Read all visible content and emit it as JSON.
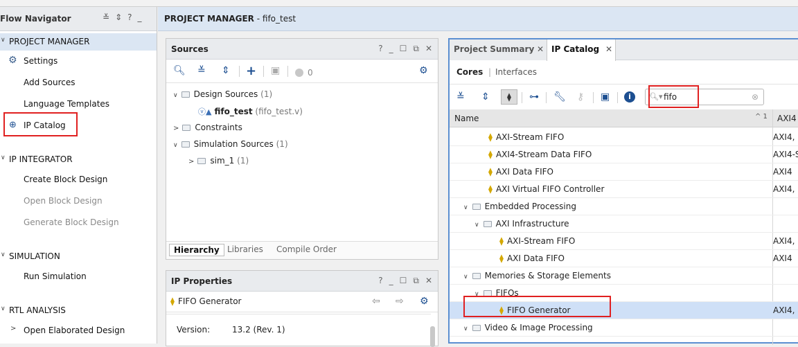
{
  "flow_navigator": {
    "title": "Flow Navigator",
    "header_icons": [
      "≚",
      "⇕",
      "?",
      "_"
    ],
    "sections": [
      {
        "label": "PROJECT MANAGER",
        "items": [
          {
            "label": "Settings",
            "disabled": false
          },
          {
            "label": "Add Sources",
            "disabled": false
          },
          {
            "label": "Language Templates",
            "disabled": false
          },
          {
            "label": "IP Catalog",
            "disabled": false
          }
        ]
      },
      {
        "label": "IP INTEGRATOR",
        "items": [
          {
            "label": "Create Block Design",
            "disabled": false
          },
          {
            "label": "Open Block Design",
            "disabled": true
          },
          {
            "label": "Generate Block Design",
            "disabled": true
          }
        ]
      },
      {
        "label": "SIMULATION",
        "items": [
          {
            "label": "Run Simulation",
            "disabled": false
          }
        ]
      },
      {
        "label": "RTL ANALYSIS",
        "items": [
          {
            "label": "Open Elaborated Design",
            "disabled": false
          }
        ]
      }
    ]
  },
  "project_manager_bar": {
    "prefix": "PROJECT MANAGER",
    "suffix": " - fifo_test"
  },
  "sources": {
    "title": "Sources",
    "count_badge": "0",
    "tree": {
      "design_sources": {
        "label": "Design Sources",
        "count": "(1)"
      },
      "top_file": {
        "name": "fifo_test",
        "file": "(fifo_test.v)"
      },
      "constraints": {
        "label": "Constraints"
      },
      "simulation_sources": {
        "label": "Simulation Sources",
        "count": "(1)"
      },
      "sim_1": {
        "label": "sim_1",
        "count": "(1)"
      }
    },
    "tabs": [
      "Hierarchy",
      "Libraries",
      "Compile Order"
    ]
  },
  "ip_properties": {
    "title": "IP Properties",
    "ip_name": "FIFO Generator",
    "version_label": "Version:",
    "version_value": "13.2 (Rev. 1)"
  },
  "ip_catalog": {
    "tabs": [
      "Project Summary",
      "IP Catalog"
    ],
    "subtabs": {
      "cores": "Cores",
      "separator": "|",
      "interfaces": "Interfaces"
    },
    "search": {
      "value": "fifo"
    },
    "columns": {
      "name": "Name",
      "sort_indicator": "^ 1",
      "col2": "AXI4"
    },
    "rows": [
      {
        "type": "ip",
        "label": "AXI-Stream FIFO",
        "col2": "AXI4,",
        "level": 2,
        "selected": false
      },
      {
        "type": "ip",
        "label": "AXI4-Stream Data FIFO",
        "col2": "AXI4-S",
        "level": 2,
        "selected": false
      },
      {
        "type": "ip",
        "label": "AXI Data FIFO",
        "col2": "AXI4",
        "level": 2,
        "selected": false
      },
      {
        "type": "ip",
        "label": "AXI Virtual FIFO Controller",
        "col2": "AXI4,",
        "level": 2,
        "selected": false
      },
      {
        "type": "folder",
        "label": "Embedded Processing",
        "col2": "",
        "level": 0,
        "selected": false
      },
      {
        "type": "folder",
        "label": "AXI Infrastructure",
        "col2": "",
        "level": 1,
        "selected": false
      },
      {
        "type": "ip",
        "label": "AXI-Stream FIFO",
        "col2": "AXI4,",
        "level": 3,
        "selected": false
      },
      {
        "type": "ip",
        "label": "AXI Data FIFO",
        "col2": "AXI4",
        "level": 3,
        "selected": false
      },
      {
        "type": "folder",
        "label": "Memories & Storage Elements",
        "col2": "",
        "level": 0,
        "selected": false
      },
      {
        "type": "folder",
        "label": "FIFOs",
        "col2": "",
        "level": 1,
        "selected": false
      },
      {
        "type": "ip",
        "label": "FIFO Generator",
        "col2": "AXI4,",
        "level": 3,
        "selected": true
      },
      {
        "type": "folder",
        "label": "Video & Image Processing",
        "col2": "",
        "level": 0,
        "selected": false
      }
    ]
  },
  "colors": {
    "highlight_box": "#e02020",
    "panel_border_active": "#5b8fd1",
    "selected_row": "#cfe0f7",
    "ip_icon": "#d4a800"
  }
}
